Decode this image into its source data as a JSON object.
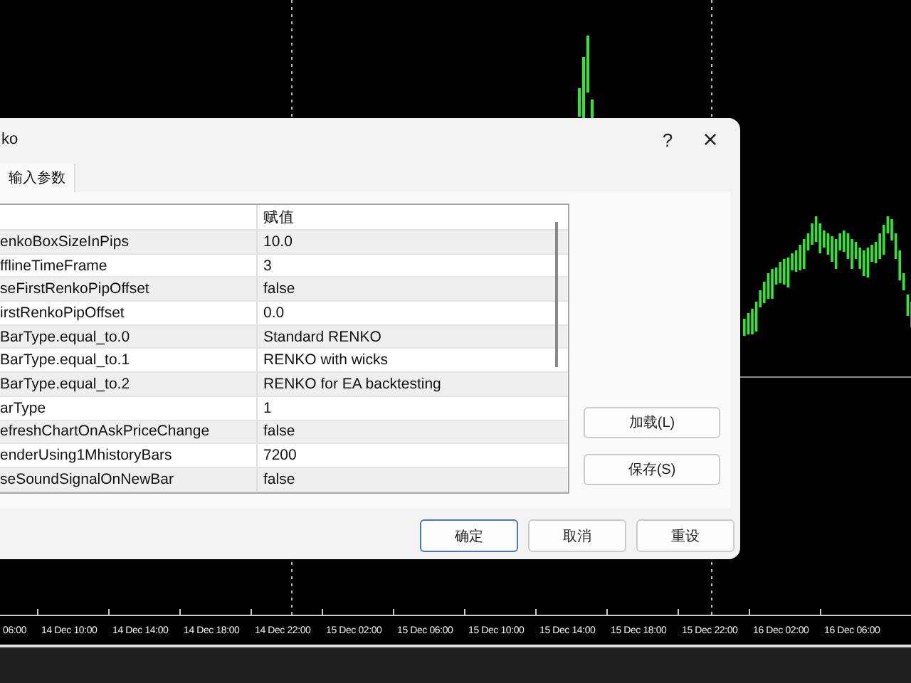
{
  "dialog": {
    "title": "ko",
    "help": "?",
    "close": "×"
  },
  "tabs": [
    {
      "label": "输入参数",
      "selected": true
    }
  ],
  "table": {
    "columns": [
      "赋值"
    ],
    "rows": [
      {
        "name": "enkoBoxSizeInPips",
        "value": "10.0"
      },
      {
        "name": "fflineTimeFrame",
        "value": "3"
      },
      {
        "name": "seFirstRenkoPipOffset",
        "value": "false"
      },
      {
        "name": "irstRenkoPipOffset",
        "value": "0.0"
      },
      {
        "name": "BarType.equal_to.0",
        "value": "Standard RENKO"
      },
      {
        "name": "BarType.equal_to.1",
        "value": "RENKO with wicks"
      },
      {
        "name": "BarType.equal_to.2",
        "value": "RENKO for EA backtesting"
      },
      {
        "name": "arType",
        "value": "1"
      },
      {
        "name": "efreshChartOnAskPriceChange",
        "value": "false"
      },
      {
        "name": "enderUsing1MhistoryBars",
        "value": "7200"
      },
      {
        "name": "seSoundSignalOnNewBar",
        "value": "false"
      }
    ]
  },
  "side_buttons": [
    "加载(L)",
    "保存(S)"
  ],
  "footer_buttons": [
    "确定",
    "取消",
    "重设"
  ],
  "time_axis": [
    "06:00",
    "14 Dec 10:00",
    "14 Dec 14:00",
    "14 Dec 18:00",
    "14 Dec 22:00",
    "15 Dec 02:00",
    "15 Dec 06:00",
    "15 Dec 10:00",
    "15 Dec 14:00",
    "15 Dec 18:00",
    "15 Dec 22:00",
    "16 Dec 02:00",
    "16 Dec 06:00"
  ]
}
